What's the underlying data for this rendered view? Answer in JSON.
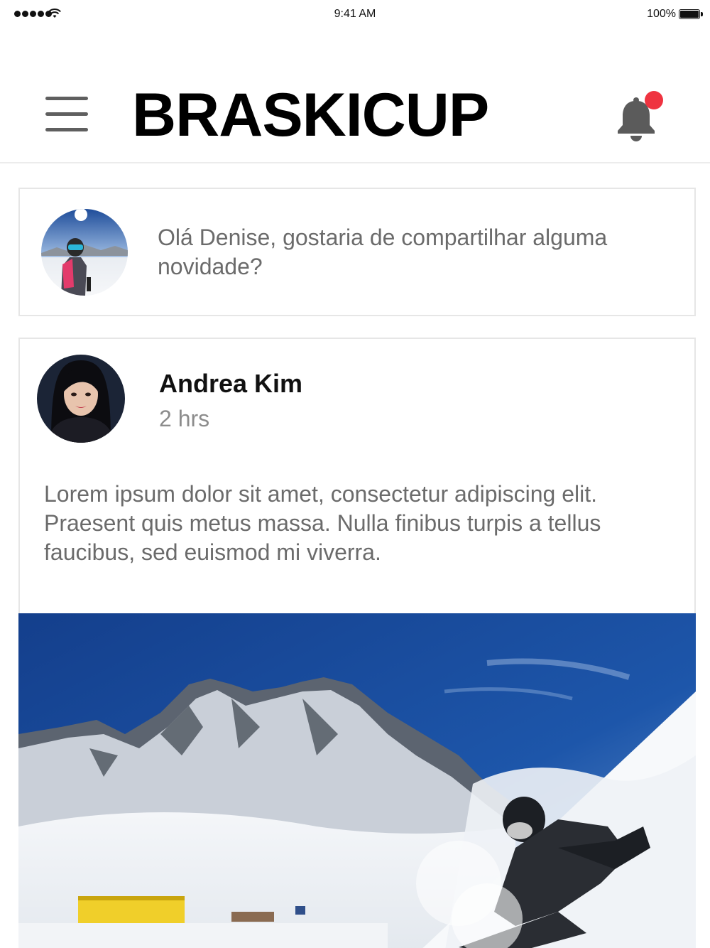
{
  "status_bar": {
    "time": "9:41 AM",
    "battery": "100%"
  },
  "header": {
    "title": "BRASKICUP",
    "menu_icon": "hamburger-menu-icon",
    "notification_icon": "bell-icon",
    "notification_badge_color": "#ef3340"
  },
  "composer": {
    "prompt": "Olá Denise, gostaria de compartilhar alguma novidade?"
  },
  "post": {
    "author": "Andrea Kim",
    "time": "2 hrs",
    "body": "Lorem ipsum dolor sit amet, consectetur adipiscing elit. Praesent quis metus massa. Nulla finibus turpis a tellus faucibus, sed euismod mi viverra."
  }
}
